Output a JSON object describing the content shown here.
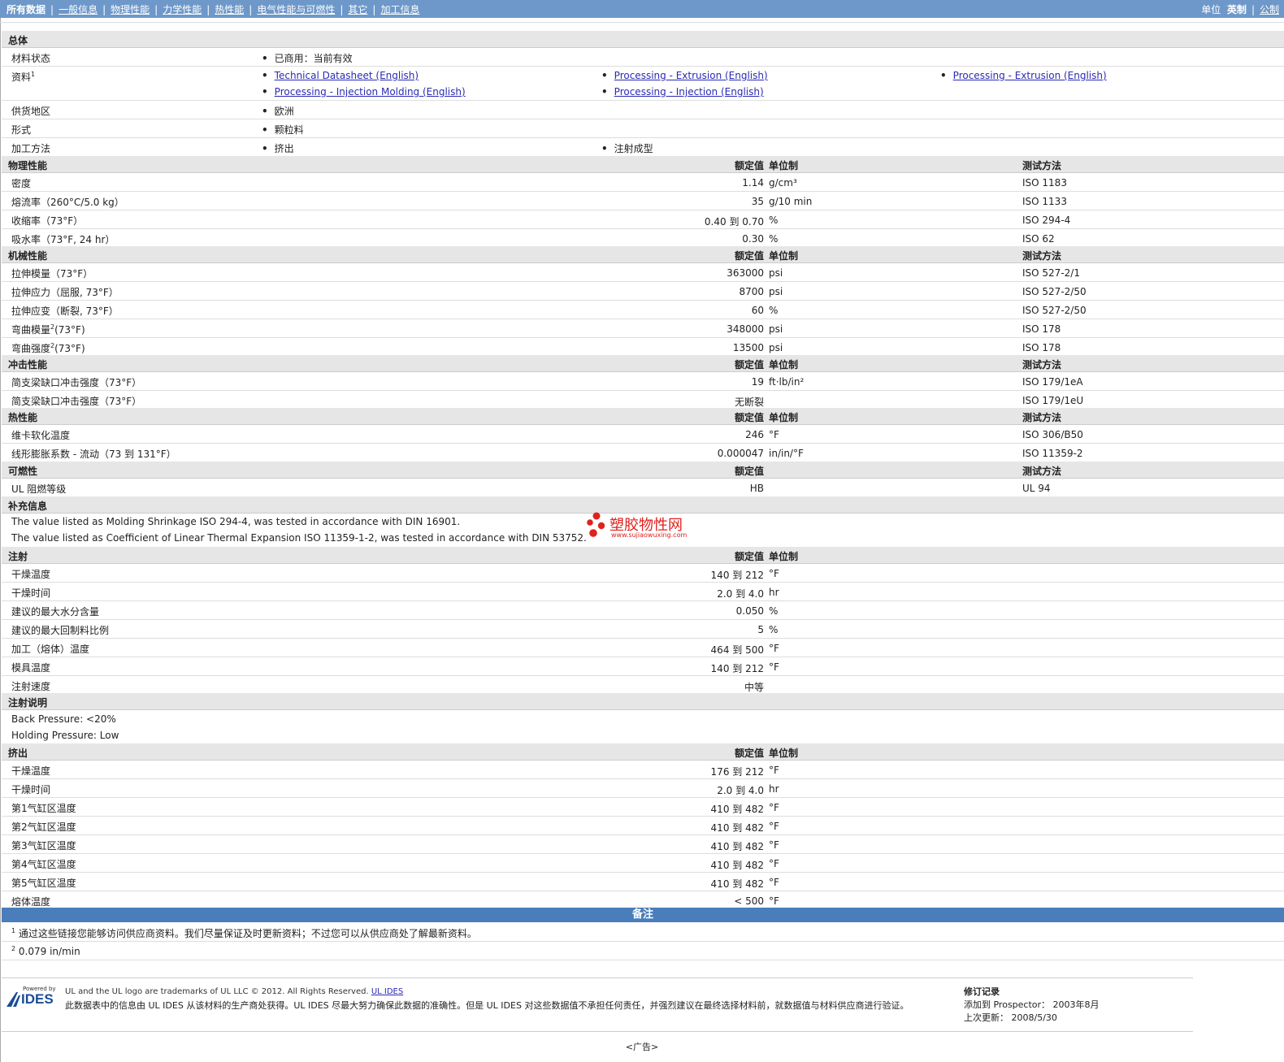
{
  "nav": {
    "tabs": [
      "所有数据",
      "一般信息",
      "物理性能",
      "力学性能",
      "热性能",
      "电气性能与可燃性",
      "其它",
      "加工信息"
    ],
    "units_label": "单位",
    "units": [
      "英制",
      "公制"
    ]
  },
  "general": {
    "title": "总体",
    "status_label": "材料状态",
    "status_value": "已商用：当前有效",
    "docs_label": "资料",
    "docs_sup": "1",
    "docs": [
      "Technical Datasheet (English)",
      "Processing - Extrusion (English)",
      "Processing - Extrusion (English)",
      "Processing - Injection Molding (English)",
      "Processing - Injection (English)"
    ],
    "region_label": "供货地区",
    "region_value": "欧洲",
    "form_label": "形式",
    "form_value": "颗粒料",
    "method_label": "加工方法",
    "methods": [
      "挤出",
      "注射成型"
    ]
  },
  "col": {
    "nominal": "额定值",
    "unit": "单位制",
    "test": "测试方法"
  },
  "physical": {
    "title": "物理性能",
    "rows": [
      {
        "label": "密度",
        "value": "1.14",
        "unit": "g/cm³",
        "test": "ISO 1183"
      },
      {
        "label": "熔流率（260°C/5.0 kg）",
        "value": "35",
        "unit": "g/10 min",
        "test": "ISO 1133"
      },
      {
        "label": "收缩率（73°F）",
        "value": "0.40 到  0.70",
        "unit": "%",
        "test": "ISO 294-4"
      },
      {
        "label": "吸水率（73°F, 24 hr）",
        "value": "0.30",
        "unit": "%",
        "test": "ISO 62"
      }
    ]
  },
  "mechanical": {
    "title": "机械性能",
    "rows": [
      {
        "label": "拉伸模量（73°F）",
        "value": "363000",
        "unit": "psi",
        "test": "ISO 527-2/1"
      },
      {
        "label": "拉伸应力（屈服, 73°F）",
        "value": "8700",
        "unit": "psi",
        "test": "ISO 527-2/50"
      },
      {
        "label": "拉伸应变（断裂, 73°F）",
        "value": "60",
        "unit": "%",
        "test": "ISO 527-2/50"
      },
      {
        "label": "弯曲模量",
        "sup": "2",
        "suffix": "(73°F)",
        "value": "348000",
        "unit": "psi",
        "test": "ISO 178"
      },
      {
        "label": "弯曲强度",
        "sup": "2",
        "suffix": "(73°F)",
        "value": "13500",
        "unit": "psi",
        "test": "ISO 178"
      }
    ]
  },
  "impact": {
    "title": "冲击性能",
    "rows": [
      {
        "label": "简支梁缺口冲击强度（73°F）",
        "value": "19",
        "unit": "ft·lb/in²",
        "test": "ISO 179/1eA"
      },
      {
        "label": "简支梁缺口冲击强度（73°F）",
        "value": "无断裂",
        "unit": "",
        "test": "ISO 179/1eU"
      }
    ]
  },
  "thermal": {
    "title": "热性能",
    "rows": [
      {
        "label": "维卡软化温度",
        "value": "246",
        "unit": "°F",
        "test": "ISO 306/B50"
      },
      {
        "label": "线形膨胀系数 - 流动（73 到  131°F）",
        "value": "0.000047",
        "unit": "in/in/°F",
        "test": "ISO 11359-2"
      }
    ]
  },
  "flammability": {
    "title": "可燃性",
    "rows": [
      {
        "label": "UL 阻燃等级",
        "value": "HB",
        "unit": "",
        "test": "UL 94"
      }
    ]
  },
  "supplement": {
    "title": "补充信息",
    "lines": [
      "The value listed as Molding Shrinkage ISO 294-4, was tested in accordance with DIN 16901.",
      "The value listed as Coefficient of Linear Thermal Expansion ISO 11359-1-2, was tested in accordance with DIN 53752."
    ]
  },
  "watermark": {
    "name": "塑胶物性网",
    "url": "www.sujiaowuxing.com",
    "color": "#e0211d"
  },
  "injection": {
    "title": "注射",
    "rows": [
      {
        "label": "干燥温度",
        "value": "140 到  212",
        "unit": "°F"
      },
      {
        "label": "干燥时间",
        "value": "2.0 到  4.0",
        "unit": "hr"
      },
      {
        "label": "建议的最大水分含量",
        "value": "0.050",
        "unit": "%"
      },
      {
        "label": "建议的最大回制料比例",
        "value": "5",
        "unit": "%"
      },
      {
        "label": "加工（熔体）温度",
        "value": "464 到  500",
        "unit": "°F"
      },
      {
        "label": "模具温度",
        "value": "140 到  212",
        "unit": "°F"
      },
      {
        "label": "注射速度",
        "value": "中等",
        "unit": ""
      }
    ]
  },
  "injection_notes": {
    "title": "注射说明",
    "lines": [
      "Back Pressure: <20%",
      "Holding Pressure: Low"
    ]
  },
  "extrusion": {
    "title": "挤出",
    "rows": [
      {
        "label": "干燥温度",
        "value": "176 到  212",
        "unit": "°F"
      },
      {
        "label": "干燥时间",
        "value": "2.0 到  4.0",
        "unit": "hr"
      },
      {
        "label": "第1气缸区温度",
        "value": "410 到  482",
        "unit": "°F"
      },
      {
        "label": "第2气缸区温度",
        "value": "410 到  482",
        "unit": "°F"
      },
      {
        "label": "第3气缸区温度",
        "value": "410 到  482",
        "unit": "°F"
      },
      {
        "label": "第4气缸区温度",
        "value": "410 到  482",
        "unit": "°F"
      },
      {
        "label": "第5气缸区温度",
        "value": "410 到  482",
        "unit": "°F"
      },
      {
        "label": "熔体温度",
        "value": "< 500",
        "unit": "°F"
      }
    ]
  },
  "notes": {
    "title": "备注",
    "items": [
      {
        "sup": "1",
        "text": "通过这些链接您能够访问供应商资料。我们尽量保证及时更新资料；不过您可以从供应商处了解最新资料。"
      },
      {
        "sup": "2",
        "text": "0.079 in/min"
      }
    ]
  },
  "footer": {
    "logo_small": "Powered by",
    "logo_text": "IDES",
    "trademark": "UL and the UL logo are trademarks of UL LLC © 2012. All Rights Reserved.",
    "trademark_link": "UL IDES",
    "disclaimer": "此数据表中的信息由  UL IDES 从该材料的生产商处获得。UL IDES 尽最大努力确保此数据的准确性。但是  UL IDES 对这些数据值不承担任何责任，并强烈建议在最终选择材料前，就数据值与材料供应商进行验证。",
    "rev_title": "修订记录",
    "rev_added": "添加到  Prospector：   2003年8月",
    "rev_updated": "上次更新：   2008/5/30",
    "ad": "<广告>"
  },
  "colors": {
    "topbar": "#6d98c9",
    "notes_bar": "#4a7ebb",
    "header_row": "#e6e6e6",
    "link": "#2a2ab4"
  }
}
